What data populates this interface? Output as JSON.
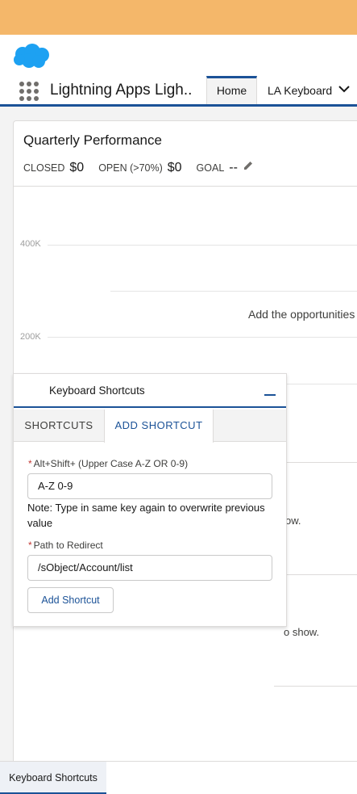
{
  "colors": {
    "banner": "#f4b76a",
    "brand_blue": "#1b5297",
    "logo_blue": "#1da1f2",
    "required_red": "#c23934"
  },
  "header": {
    "logo_icon": "salesforce-cloud-icon"
  },
  "nav": {
    "launcher_icon": "app-launcher-icon",
    "app_name": "Lightning Apps Ligh..",
    "tabs": [
      {
        "label": "Home",
        "active": true
      },
      {
        "label": "LA Keyboard",
        "active": false
      }
    ],
    "more_icon": "chevron-down-icon"
  },
  "performance": {
    "title": "Quarterly Performance",
    "closed_label": "CLOSED",
    "closed_value": "$0",
    "open_label": "OPEN (>70%)",
    "open_value": "$0",
    "goal_label": "GOAL",
    "goal_value": "--",
    "edit_icon": "pencil-icon",
    "axis_labels": [
      "400K",
      "200K"
    ],
    "empty_message": "Add the opportunities"
  },
  "background_text": {
    "line1": "ow.",
    "line2": "o show."
  },
  "panel": {
    "title": "Keyboard Shortcuts",
    "minimize_icon": "minimize-icon",
    "tabs": [
      {
        "label": "SHORTCUTS",
        "active": false
      },
      {
        "label": "ADD SHORTCUT",
        "active": true
      }
    ],
    "key_field": {
      "required": "*",
      "label": "Alt+Shift+ (Upper Case A-Z OR 0-9)",
      "value": "A-Z 0-9"
    },
    "note": "Note: Type in same key again to overwrite previous value",
    "path_field": {
      "required": "*",
      "label": "Path to Redirect",
      "value": "/sObject/Account/list"
    },
    "add_button": "Add Shortcut"
  },
  "utility_bar": {
    "item": "Keyboard Shortcuts"
  }
}
